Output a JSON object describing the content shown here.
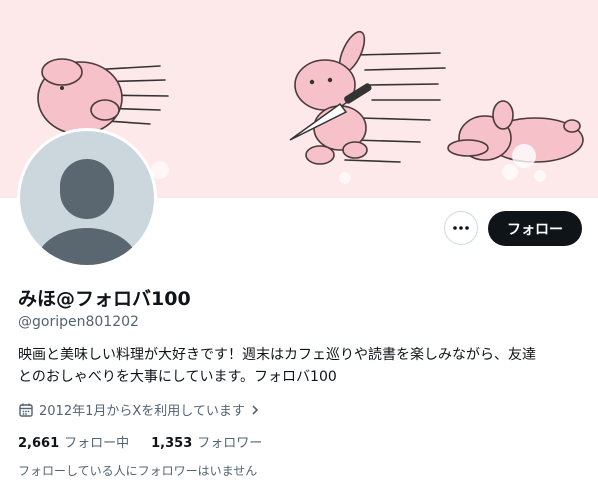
{
  "profile": {
    "display_name": "みほ@フォロバ100",
    "handle": "@goripen801202",
    "bio_line1": "映画と美味しい料理が大好きです！週末はカフェ巡りや読書を楽しみながら、友達",
    "bio_line2": "とのおしゃべりを大事にしています。フォロバ100",
    "joined": "2012年1月からXを利用しています",
    "following_count": "2,661",
    "following_label": "フォロー中",
    "followers_count": "1,353",
    "followers_label": "フォロワー",
    "followed_by_text": "フォローしている人にフォロワーはいません"
  },
  "actions": {
    "follow_label": "フォロー",
    "more_icon": "more-icon"
  },
  "colors": {
    "banner_bg": "#fde8ea",
    "bunny_pink": "#f7c1c9",
    "avatar_bg": "#ccd6dd",
    "avatar_fg": "#5b6770",
    "follow_btn_bg": "#0f1419",
    "secondary_text": "#536471"
  }
}
